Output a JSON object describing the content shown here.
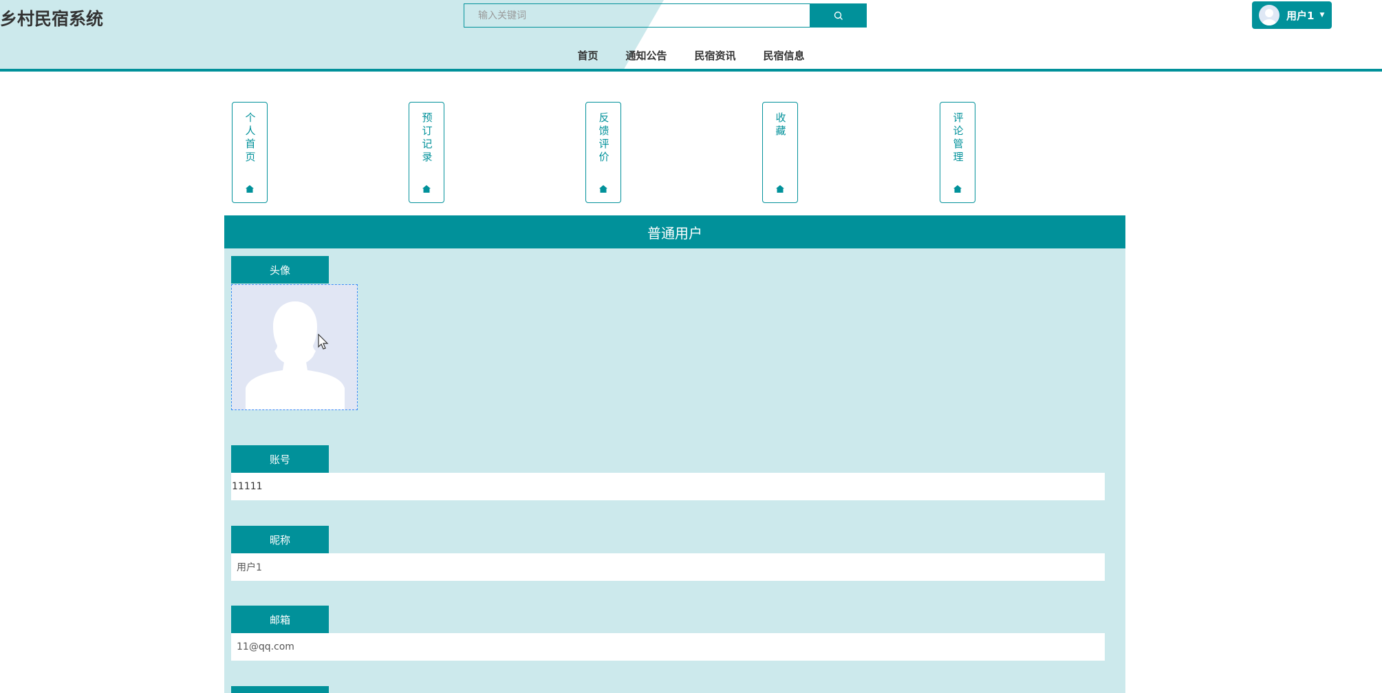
{
  "header": {
    "site_title": "乡村民宿系统",
    "search_placeholder": "输入关键词",
    "user_name": "用户1"
  },
  "nav": {
    "items": [
      "首页",
      "通知公告",
      "民宿资讯",
      "民宿信息"
    ]
  },
  "tiles": [
    "个人首页",
    "预订记录",
    "反馈评价",
    "收藏",
    "评论管理"
  ],
  "panel": {
    "title": "普通用户",
    "avatar_label": "头像",
    "account_label": "账号",
    "account_value": "11111",
    "nickname_label": "昵称",
    "nickname_value": "用户1",
    "email_label": "邮箱",
    "email_value": "11@qq.com"
  },
  "colors": {
    "accent": "#01919a",
    "panel_bg": "#cce9ec",
    "avatar_bg": "#e1e6f4"
  }
}
